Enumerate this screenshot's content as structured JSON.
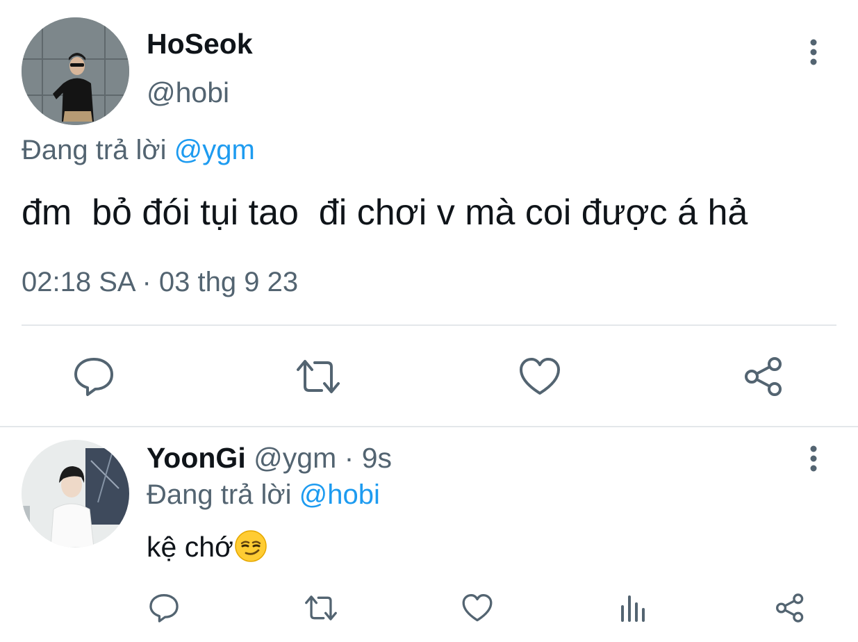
{
  "main_tweet": {
    "author": {
      "name": "HoSeok",
      "handle": "@hobi"
    },
    "reply_to_prefix": "Đang trả lời",
    "reply_to_handle": "@ygm",
    "text": "đm  bỏ đói tụi tao  đi chơi v mà coi được á hả",
    "timestamp": "02:18 SA · 03 thg 9 23",
    "actions": [
      "reply-icon",
      "retweet-icon",
      "like-icon",
      "share-icon"
    ]
  },
  "reply_tweet": {
    "author": {
      "name": "YoonGi",
      "handle": "@ygm"
    },
    "separator": "·",
    "time": "9s",
    "reply_to_prefix": "Đang trả lời",
    "reply_to_handle": "@hobi",
    "text": "kệ chớ",
    "emoji": "smirking-face",
    "actions": [
      "reply-icon",
      "retweet-icon",
      "like-icon",
      "views-icon",
      "share-icon"
    ]
  },
  "colors": {
    "text_primary": "#0f1419",
    "text_secondary": "#536471",
    "link": "#1d9bf0",
    "divider": "#e3e7ea"
  }
}
